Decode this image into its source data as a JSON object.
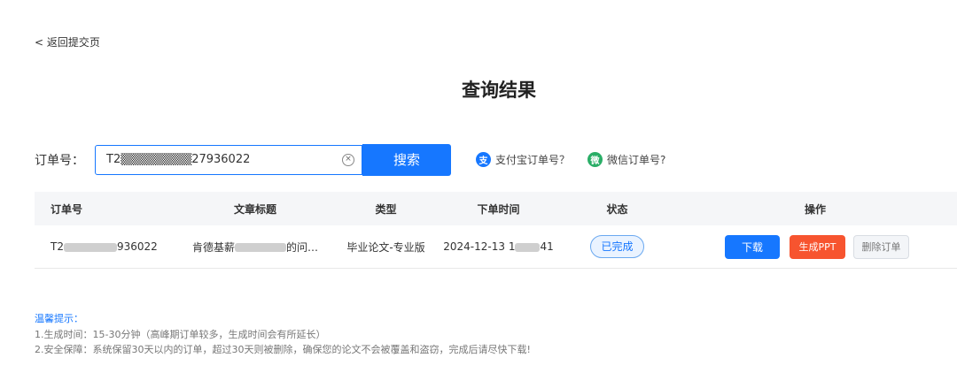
{
  "nav": {
    "back_label": "< 返回提交页"
  },
  "page": {
    "title": "查询结果"
  },
  "search": {
    "label": "订单号：",
    "value": "T2▒▒▒▒▒▒▒▒27936022",
    "button_label": "搜索",
    "alipay_link": "支付宝订单号？",
    "wechat_link": "微信订单号?"
  },
  "table": {
    "headers": [
      "订单号",
      "文章标题",
      "类型",
      "下单时间",
      "状态",
      "操作"
    ],
    "rows": [
      {
        "order_prefix": "T2",
        "order_suffix": "936022",
        "title_prefix": "肯德基薪",
        "title_suffix": "的问…",
        "type": "毕业论文-专业版",
        "time_prefix": "2024-12-13 1",
        "time_suffix": "41",
        "status": "已完成",
        "download_label": "下载",
        "ppt_label": "生成PPT",
        "delete_label": "删除订单"
      }
    ]
  },
  "tips": {
    "title": "温馨提示：",
    "line1": "1.生成时间：15-30分钟（高峰期订单较多，生成时间会有所延长）",
    "line2": "2.安全保障：系统保留30天以内的订单，超过30天则被删除，确保您的论文不会被覆盖和盗窃，完成后请尽快下载!"
  },
  "colors": {
    "accent": "#1677ff",
    "ppt": "#f7542f",
    "wechat": "#2aae67"
  },
  "icons": {
    "clear": "clear-circle-icon",
    "alipay": "alipay-icon",
    "wechat": "wechat-icon"
  }
}
